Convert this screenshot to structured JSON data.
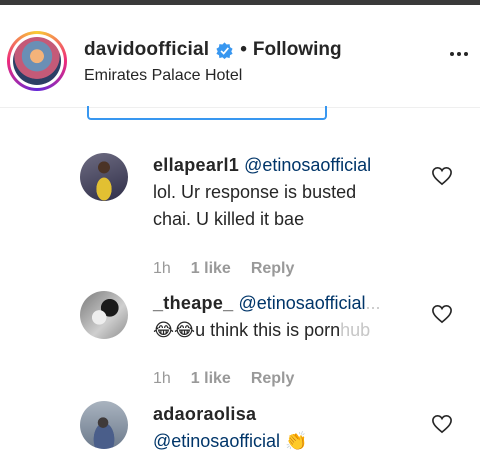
{
  "header": {
    "username": "davidoofficial",
    "separator": "•",
    "follow_status": "Following",
    "location": "Emirates Palace Hotel",
    "verified_icon": "verified-badge-icon",
    "more_icon": "more-options-icon"
  },
  "comments": [
    {
      "username": "ellapearl1",
      "mention": "@etinosaofficial",
      "text_line1": "lol. Ur response is busted",
      "text_line2": "chai. U killed it bae",
      "time": "1h",
      "likes": "1 like",
      "reply": "Reply"
    },
    {
      "username": "_theape_",
      "mention": "@etinosaofficial",
      "mention_fade": "...",
      "emoji": "😂😂",
      "text": "u think this is porn",
      "text_fade": "hub",
      "time": "1h",
      "likes": "1 like",
      "reply": "Reply"
    },
    {
      "username": "adaoraolisa",
      "mention": "@etinosaofficial",
      "emoji": "👏"
    }
  ],
  "colors": {
    "text": "#262626",
    "meta": "#999999",
    "mention": "#003569",
    "verified": "#3897f0"
  }
}
